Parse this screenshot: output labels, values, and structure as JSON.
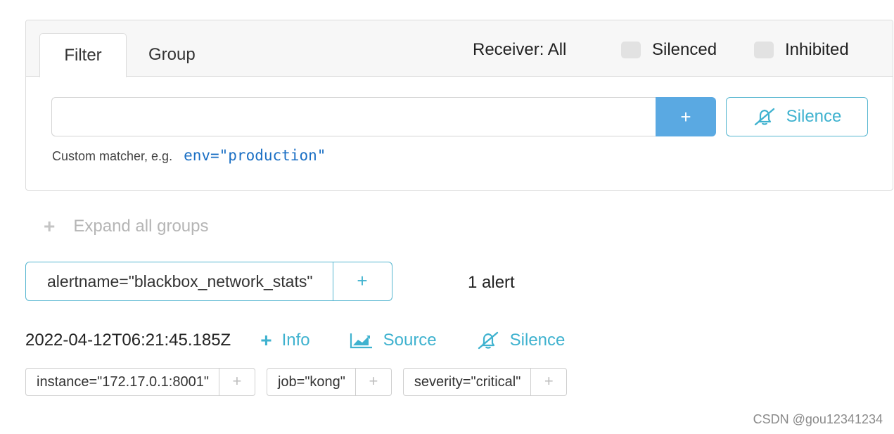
{
  "tabs": {
    "filter": "Filter",
    "group": "Group"
  },
  "header": {
    "receiver": "Receiver: All",
    "silenced_label": "Silenced",
    "inhibited_label": "Inhibited"
  },
  "filter": {
    "input_value": "",
    "add_label": "+",
    "silence_label": "Silence",
    "hint_text": "Custom matcher, e.g.",
    "hint_example": "env=\"production\""
  },
  "expand": {
    "label": "Expand all groups",
    "icon": "+"
  },
  "group": {
    "label": "alertname=\"blackbox_network_stats\"",
    "add_label": "+",
    "count": "1 alert"
  },
  "alert": {
    "timestamp": "2022-04-12T06:21:45.185Z",
    "info_label": "Info",
    "source_label": "Source",
    "silence_label": "Silence",
    "labels": [
      {
        "text": "instance=\"172.17.0.1:8001\"",
        "add": "+"
      },
      {
        "text": "job=\"kong\"",
        "add": "+"
      },
      {
        "text": "severity=\"critical\"",
        "add": "+"
      }
    ]
  },
  "watermark": "CSDN @gou12341234",
  "colors": {
    "accent": "#3fb2cf",
    "primary_button": "#5aa9e2",
    "muted": "#b5b5b5",
    "link_code": "#1a6fc4"
  }
}
